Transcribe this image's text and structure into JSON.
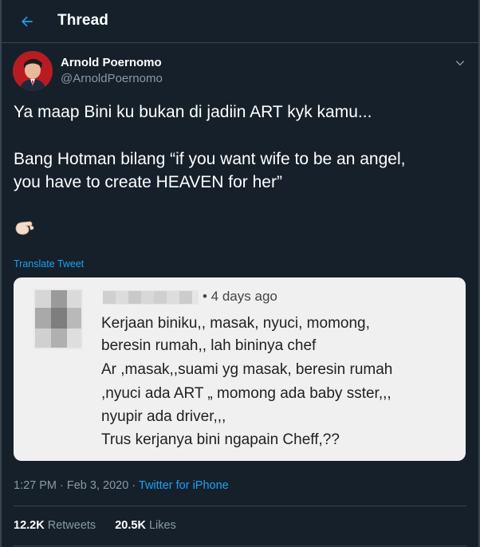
{
  "header": {
    "title": "Thread"
  },
  "author": {
    "name": "Arnold Poernomo",
    "handle": "@ArnoldPoernomo"
  },
  "tweet": {
    "lines": [
      "Ya maap Bini ku bukan di jadiin ART kyk kamu...",
      "Bang Hotman bilang “if you want wife to be an angel,",
      "you have to create HEAVEN for her”"
    ],
    "translate_label": "Translate Tweet"
  },
  "quoted": {
    "time": "• 4 days ago",
    "lines": [
      "Kerjaan biniku,, masak, nyuci, momong,",
      "beresin rumah,, lah bininya chef",
      "Ar ,masak,,suami yg masak, beresin rumah",
      ",nyuci ada ART „ momong ada baby sster,,,",
      "nyupir ada driver,,,",
      "Trus kerjanya bini ngapain Cheff,??"
    ]
  },
  "meta": {
    "time": "1:27 PM · Feb 3, 2020 · ",
    "source": "Twitter for iPhone"
  },
  "stats": {
    "retweets_count": "12.2K",
    "retweets_label": "Retweets",
    "likes_count": "20.5K",
    "likes_label": "Likes"
  },
  "icons": {
    "back": "back-arrow-icon",
    "more": "chevron-down-icon",
    "emoji": "pinching-hand-emoji"
  },
  "colors": {
    "background": "#15202b",
    "accent": "#1da1f2",
    "muted": "#8899a6",
    "border": "#38444d"
  }
}
